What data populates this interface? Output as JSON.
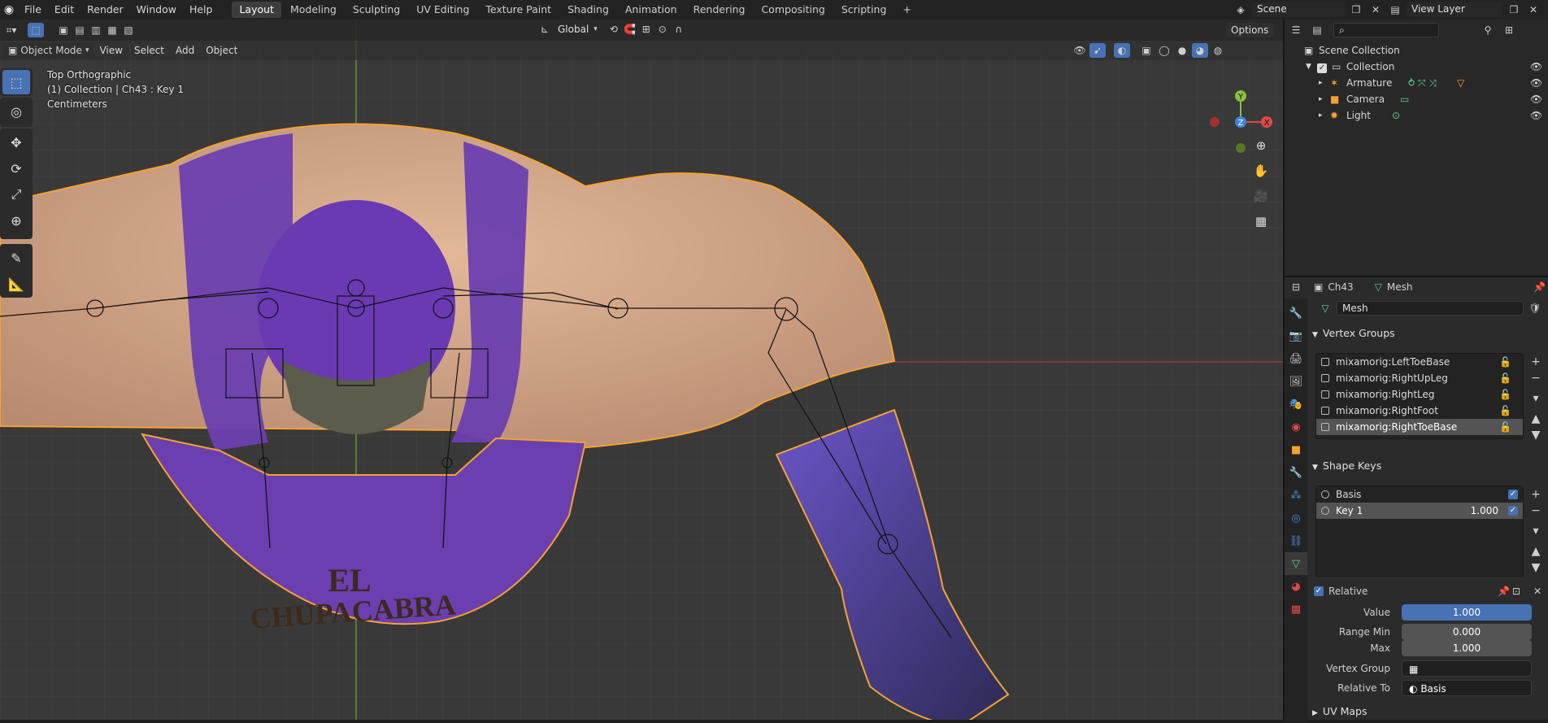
{
  "menu": [
    "File",
    "Edit",
    "Render",
    "Window",
    "Help"
  ],
  "workspaces": [
    "Layout",
    "Modeling",
    "Sculpting",
    "UV Editing",
    "Texture Paint",
    "Shading",
    "Animation",
    "Rendering",
    "Compositing",
    "Scripting"
  ],
  "active_workspace": "Layout",
  "scene_name": "Scene",
  "view_layer": "View Layer",
  "header": {
    "orientation": "Global",
    "options": "Options"
  },
  "viewport_menu": {
    "mode": "Object Mode",
    "items": [
      "View",
      "Select",
      "Add",
      "Object"
    ]
  },
  "overlay": {
    "view_name": "Top Orthographic",
    "collection_info": "(1) Collection | Ch43 : Key 1",
    "units": "Centimeters"
  },
  "gizmo": {
    "y": "Y",
    "z": "Z",
    "x": "X"
  },
  "model_text": {
    "line1": "EL",
    "line2": "CHUPACABRA"
  },
  "outliner": {
    "scene_collection": "Scene Collection",
    "collection": "Collection",
    "items": [
      "Armature",
      "Camera",
      "Light"
    ]
  },
  "properties": {
    "object_name": "Ch43",
    "data_name": "Mesh",
    "mesh_field": "Mesh",
    "vertex_groups_title": "Vertex Groups",
    "vertex_groups": [
      "mixamorig:LeftToeBase",
      "mixamorig:RightUpLeg",
      "mixamorig:RightLeg",
      "mixamorig:RightFoot",
      "mixamorig:RightToeBase"
    ],
    "selected_vertex_group": "mixamorig:RightToeBase",
    "shape_keys_title": "Shape Keys",
    "shape_keys": [
      {
        "name": "Basis",
        "value": ""
      },
      {
        "name": "Key 1",
        "value": "1.000"
      }
    ],
    "relative_label": "Relative",
    "value_label": "Value",
    "value": "1.000",
    "range_min_label": "Range Min",
    "range_min": "0.000",
    "max_label": "Max",
    "max": "1.000",
    "vertex_group_label": "Vertex Group",
    "vertex_group_value": "",
    "relative_to_label": "Relative To",
    "relative_to": "Basis",
    "uv_maps_title": "UV Maps"
  },
  "colors": {
    "accent": "#4772b3",
    "outline": "#f5a231",
    "shirt": "#6b3fb0",
    "skin": "#d7a989"
  }
}
